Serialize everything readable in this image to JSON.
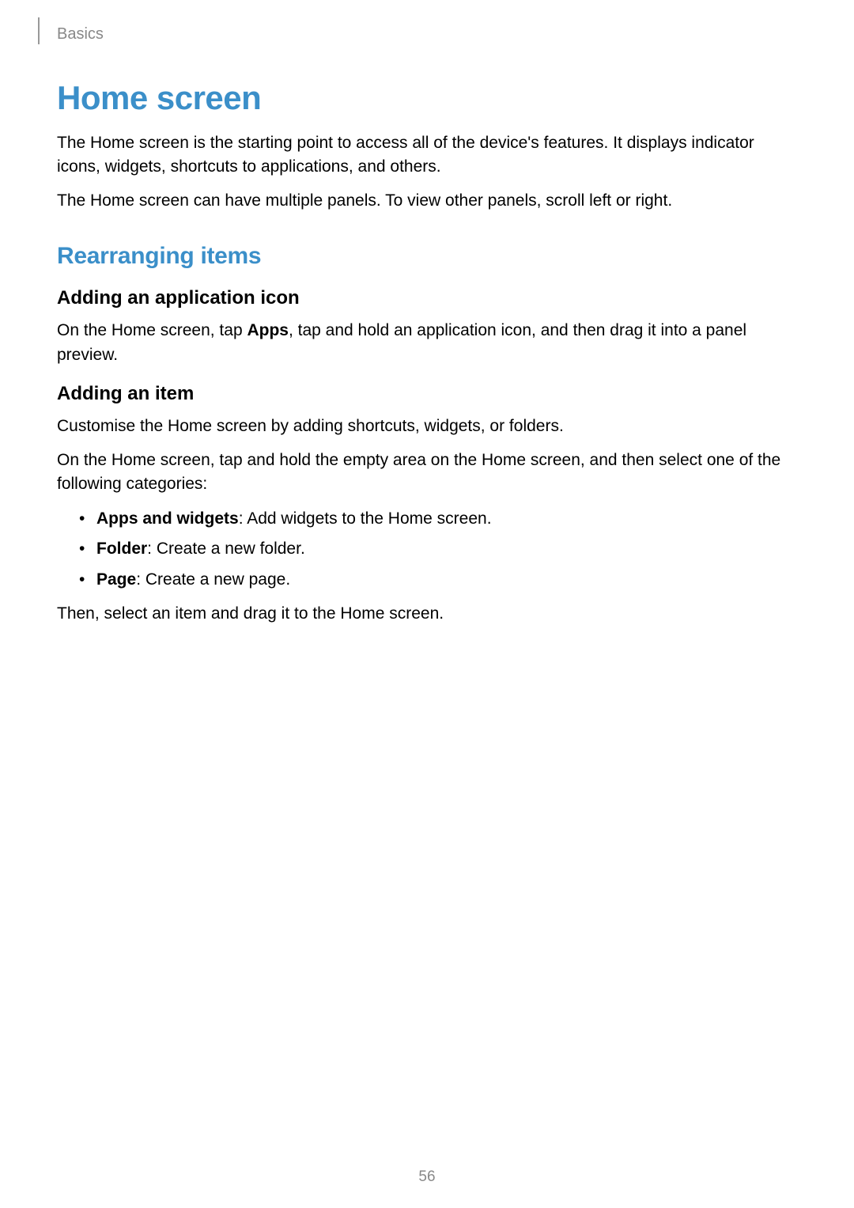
{
  "header": {
    "section": "Basics"
  },
  "page": {
    "number": "56"
  },
  "h1": "Home screen",
  "intro": {
    "p1": "The Home screen is the starting point to access all of the device's features. It displays indicator icons, widgets, shortcuts to applications, and others.",
    "p2": "The Home screen can have multiple panels. To view other panels, scroll left or right."
  },
  "h2_1": "Rearranging items",
  "section1": {
    "h3": "Adding an application icon",
    "p_pre": "On the Home screen, tap ",
    "p_bold": "Apps",
    "p_post": ", tap and hold an application icon, and then drag it into a panel preview."
  },
  "section2": {
    "h3": "Adding an item",
    "p1": "Customise the Home screen by adding shortcuts, widgets, or folders.",
    "p2": "On the Home screen, tap and hold the empty area on the Home screen, and then select one of the following categories:",
    "bullets": [
      {
        "bold": "Apps and widgets",
        "rest": ": Add widgets to the Home screen."
      },
      {
        "bold": "Folder",
        "rest": ": Create a new folder."
      },
      {
        "bold": "Page",
        "rest": ": Create a new page."
      }
    ],
    "p3": "Then, select an item and drag it to the Home screen."
  }
}
